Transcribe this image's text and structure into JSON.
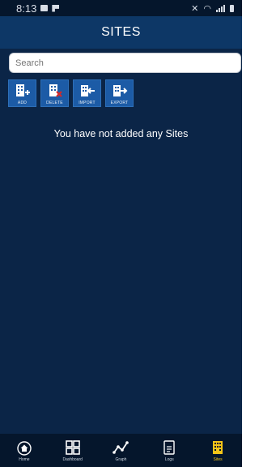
{
  "status_bar": {
    "time": "8:13"
  },
  "header": {
    "title": "SITES"
  },
  "search": {
    "placeholder": "Search"
  },
  "toolbar": {
    "add_label": "ADD",
    "delete_label": "DELETE",
    "import_label": "IMPORT",
    "export_label": "EXPORT"
  },
  "main": {
    "empty_message": "You have not added any Sites"
  },
  "bottom_nav": {
    "items": [
      {
        "label": "Home",
        "icon": "home-icon"
      },
      {
        "label": "Dashboard",
        "icon": "dashboard-icon"
      },
      {
        "label": "Graph",
        "icon": "graph-icon"
      },
      {
        "label": "Logs",
        "icon": "logs-icon"
      },
      {
        "label": "Sites",
        "icon": "sites-icon",
        "active": true
      }
    ]
  },
  "colors": {
    "background": "#0b2547",
    "header": "#0d3766",
    "toolbar_button": "#1c5ba6",
    "active_tab": "#f5c518"
  }
}
